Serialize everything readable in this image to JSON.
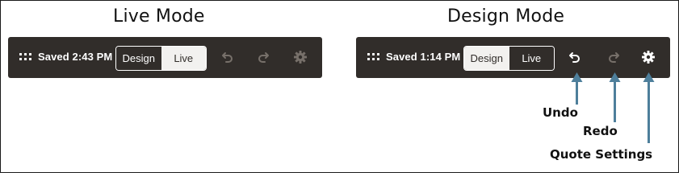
{
  "live_section": {
    "heading": "Live Mode",
    "toolbar": {
      "saved_text": "Saved 2:43 PM",
      "mode_toggle": {
        "design_label": "Design",
        "live_label": "Live",
        "selected": "Live"
      },
      "undo_icon": "undo-icon",
      "redo_icon": "redo-icon",
      "settings_icon": "gear-icon"
    }
  },
  "design_section": {
    "heading": "Design Mode",
    "toolbar": {
      "saved_text": "Saved 1:14 PM",
      "mode_toggle": {
        "design_label": "Design",
        "live_label": "Live",
        "selected": "Design"
      },
      "undo_icon": "undo-icon",
      "redo_icon": "redo-icon",
      "settings_icon": "gear-icon"
    }
  },
  "callouts": {
    "undo": "Undo",
    "redo": "Redo",
    "settings": "Quote Settings"
  },
  "colors": {
    "toolbar_bg": "#312d2a",
    "arrow": "#4e7f9b",
    "icon_enabled": "#ffffff",
    "icon_disabled": "#77706a"
  }
}
